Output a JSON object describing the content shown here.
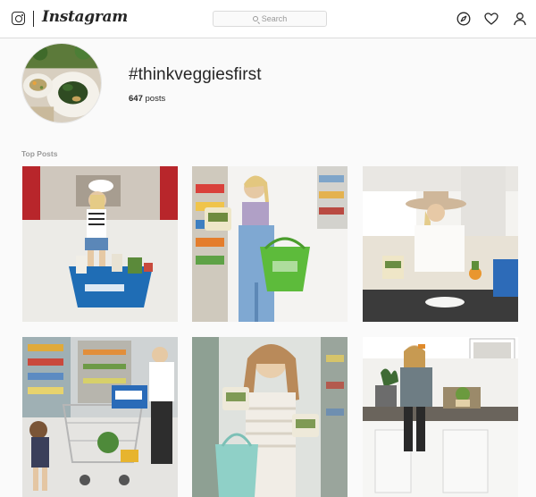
{
  "header": {
    "brand": "Instagram",
    "search_placeholder": "Search",
    "icons": [
      "instagram-glyph-icon",
      "compass-icon",
      "heart-icon",
      "profile-icon"
    ]
  },
  "profile": {
    "hashtag": "#thinkveggiesfirst",
    "post_count": "647",
    "post_count_suffix": " posts"
  },
  "top_posts": {
    "label": "Top Posts",
    "count": 6
  },
  "colors": {
    "header_bg": "#ffffff",
    "page_bg": "#fafafa",
    "border": "#dbdbdb",
    "text": "#262626",
    "muted": "#999999"
  }
}
